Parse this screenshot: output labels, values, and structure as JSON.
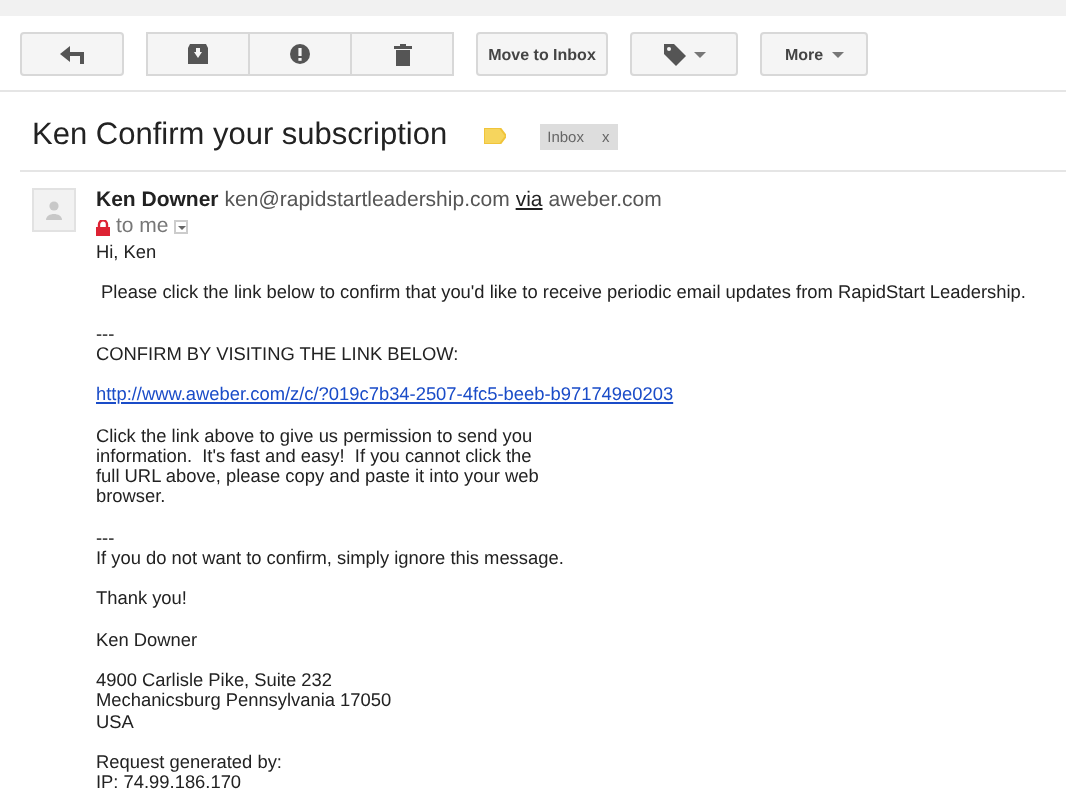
{
  "toolbar": {
    "move_button": "Move to Inbox",
    "more_button": "More"
  },
  "subject": {
    "title": "Ken Confirm your subscription",
    "important": true,
    "labels": [
      {
        "text": "Inbox",
        "remove": "x"
      }
    ]
  },
  "message": {
    "sender_name": "Ken Downer",
    "sender_email": "ken@rapidstartleadership.com",
    "via": "via",
    "via_domain": "aweber.com",
    "recipient": "to me",
    "body": [
      {
        "kind": "text",
        "lines": [
          "Hi, Ken"
        ]
      },
      {
        "kind": "text",
        "lines": [
          " Please click the link below to confirm that you'd like to receive periodic email updates from RapidStart Leadership."
        ]
      },
      {
        "kind": "text",
        "lines": [
          "---",
          "CONFIRM BY VISITING THE LINK BELOW:"
        ]
      },
      {
        "kind": "link",
        "lines": [
          "http://www.aweber.com/z/c/?019c7b34-2507-4fc5-beeb-b971749e0203"
        ]
      },
      {
        "kind": "text",
        "lines": [
          "Click the link above to give us permission to send you",
          "information.  It's fast and easy!  If you cannot click the",
          "full URL above, please copy and paste it into your web",
          "browser."
        ]
      },
      {
        "kind": "text",
        "lines": [
          "---",
          "If you do not want to confirm, simply ignore this message."
        ]
      },
      {
        "kind": "text",
        "lines": [
          "Thank you!"
        ]
      },
      {
        "kind": "text",
        "lines": [
          "Ken Downer"
        ]
      },
      {
        "kind": "text",
        "lines": [
          "4900 Carlisle Pike, Suite 232",
          "Mechanicsburg Pennsylvania 17050",
          "USA"
        ]
      },
      {
        "kind": "text",
        "lines": [
          "Request generated by:",
          "IP: 74.99.186.170"
        ]
      }
    ]
  }
}
